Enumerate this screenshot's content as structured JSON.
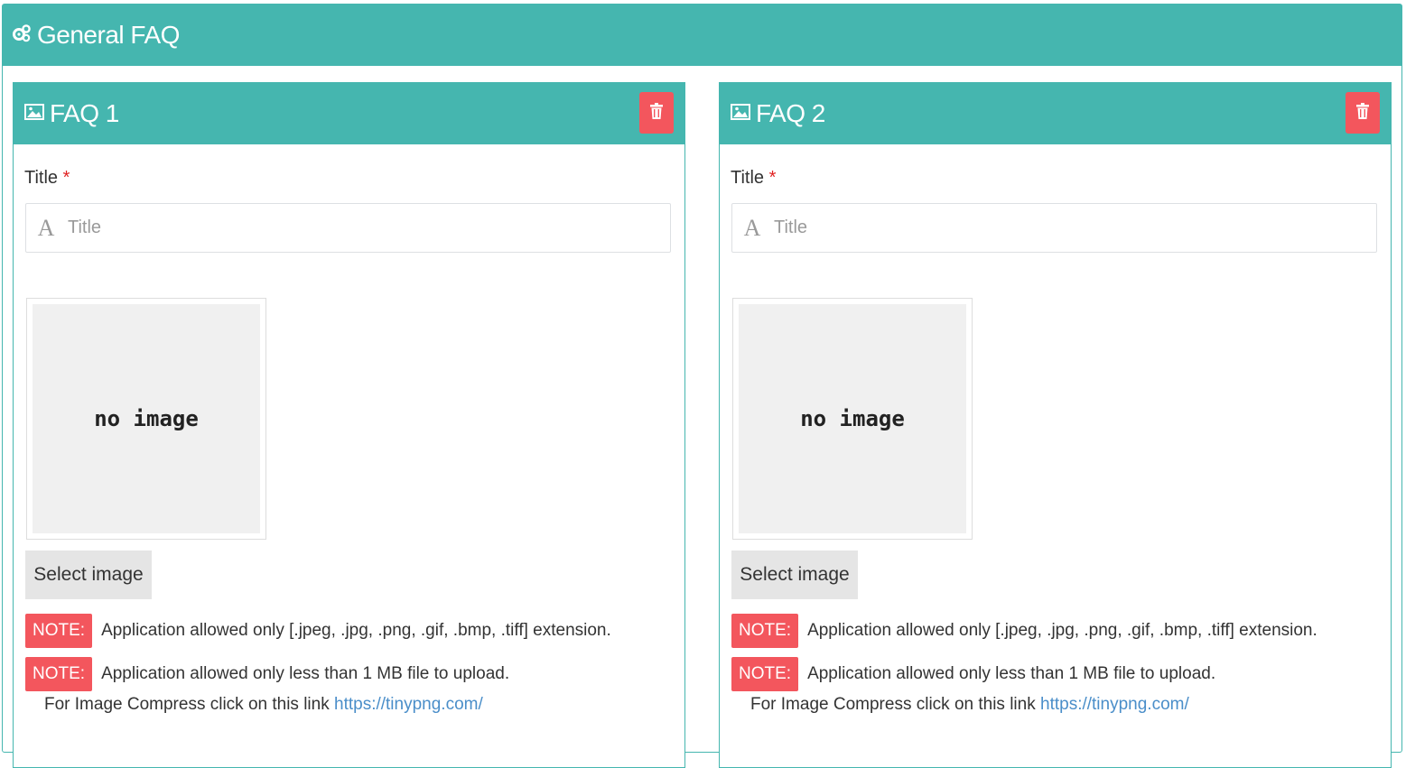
{
  "header": {
    "title": "General FAQ",
    "icon": "gears-icon"
  },
  "colors": {
    "teal": "#45b6af",
    "danger": "#f3565d",
    "link": "#4a8ec9"
  },
  "faqs": [
    {
      "title": "FAQ 1",
      "field_label": "Title",
      "required_mark": "*",
      "title_placeholder": "Title",
      "title_value": "",
      "no_image_text": "no image",
      "select_image_label": "Select image",
      "note_badge": "NOTE:",
      "note1": "Application allowed only [.jpeg, .jpg, .png, .gif, .bmp, .tiff] extension.",
      "note2": "Application allowed only less than 1 MB file to upload.",
      "compress_text": "For Image Compress click on this link",
      "compress_link": "https://tinypng.com/"
    },
    {
      "title": "FAQ 2",
      "field_label": "Title",
      "required_mark": "*",
      "title_placeholder": "Title",
      "title_value": "",
      "no_image_text": "no image",
      "select_image_label": "Select image",
      "note_badge": "NOTE:",
      "note1": "Application allowed only [.jpeg, .jpg, .png, .gif, .bmp, .tiff] extension.",
      "note2": "Application allowed only less than 1 MB file to upload.",
      "compress_text": "For Image Compress click on this link",
      "compress_link": "https://tinypng.com/"
    }
  ]
}
